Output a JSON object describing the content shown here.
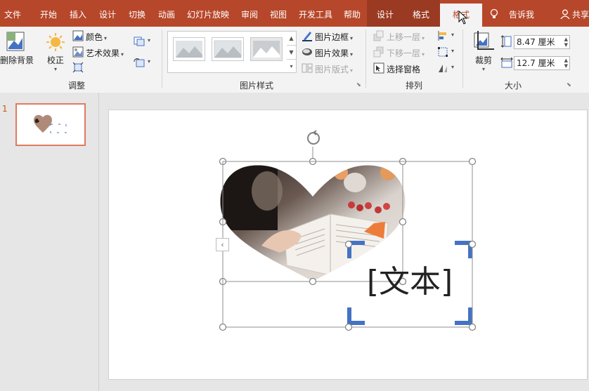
{
  "tabs": {
    "file": "文件",
    "home": "开始",
    "insert": "插入",
    "design": "设计",
    "transitions": "切换",
    "animations": "动画",
    "slideshow": "幻灯片放映",
    "review": "审阅",
    "view": "视图",
    "developer": "开发工具",
    "help": "帮助",
    "ctx_design": "设计",
    "ctx_format": "格式",
    "format_active": "格式",
    "tell_me": "告诉我",
    "share": "共享"
  },
  "ribbon": {
    "adjust": {
      "remove_bg": "删除背景",
      "correct": "校正",
      "color": "颜色",
      "artistic": "艺术效果",
      "group_label": "调整"
    },
    "picture_styles": {
      "border": "图片边框",
      "effects": "图片效果",
      "layout": "图片版式",
      "group_label": "图片样式"
    },
    "arrange": {
      "bring_forward": "上移一层",
      "send_backward": "下移一层",
      "selection_pane": "选择窗格",
      "group_label": "排列"
    },
    "size": {
      "crop": "裁剪",
      "height": "8.47 厘米",
      "width": "12.7 厘米",
      "group_label": "大小"
    }
  },
  "slides": {
    "number": "1"
  },
  "slide": {
    "text_placeholder": "[文本]"
  },
  "colors": {
    "accent": "#b7472a",
    "context": "#9a3a22",
    "bracket": "#4472c4"
  }
}
